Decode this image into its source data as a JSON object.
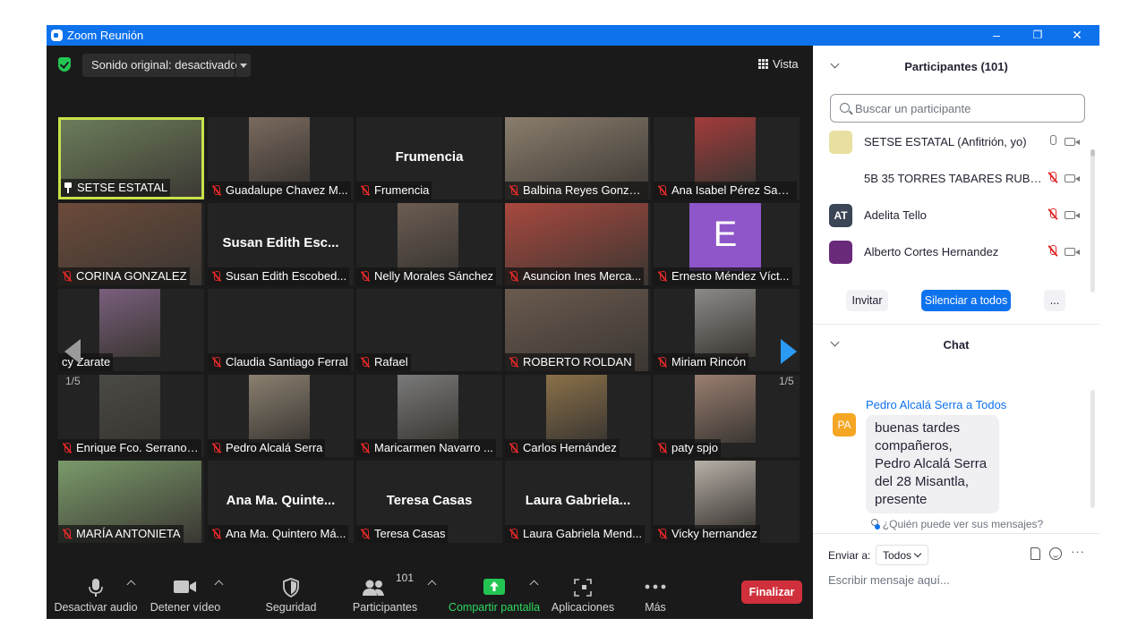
{
  "window": {
    "title": "Zoom Reunión",
    "minimize": "–",
    "restore": "❐",
    "close": "✕"
  },
  "stage": {
    "audio_original": "Sonido original: desactivado",
    "view_label": "Vista",
    "page_left": "1/5",
    "page_right": "1/5"
  },
  "tiles": [
    {
      "label": "SETSE ESTATAL",
      "big": "",
      "muted": false,
      "pinned": true,
      "video": "full",
      "color": "#6b7c5a"
    },
    {
      "label": "Guadalupe Chavez M...",
      "big": "",
      "muted": true,
      "video": "center",
      "color": "#7a6a5e"
    },
    {
      "label": "Frumencia",
      "big": "Frumencia",
      "muted": true,
      "video": "none",
      "color": ""
    },
    {
      "label": "Balbina Reyes Gonzal...",
      "big": "",
      "muted": true,
      "video": "full",
      "color": "#8a7e6d"
    },
    {
      "label": "Ana Isabel Pérez Sant...",
      "big": "",
      "muted": true,
      "video": "center",
      "color": "#a33b3b"
    },
    {
      "label": "CORINA GONZALEZ",
      "big": "",
      "muted": true,
      "video": "full",
      "color": "#6b4a3a"
    },
    {
      "label": "Susan Edith Escobed...",
      "big": "Susan Edith Esc...",
      "muted": true,
      "video": "none",
      "color": ""
    },
    {
      "label": "Nelly Morales Sánchez",
      "big": "",
      "muted": true,
      "video": "center",
      "color": "#6c5d52"
    },
    {
      "label": "Asuncion Ines Merca...",
      "big": "",
      "muted": true,
      "video": "full",
      "color": "#a8483e"
    },
    {
      "label": "Ernesto Méndez Víct...",
      "big": "",
      "muted": true,
      "video": "avatar",
      "color": "#8e56c8",
      "avatar_letter": "E"
    },
    {
      "label": "cy Zarate",
      "big": "",
      "muted": false,
      "video": "center",
      "color": "#7a5f7e"
    },
    {
      "label": "Claudia Santiago Ferral",
      "big": "",
      "muted": true,
      "video": "none",
      "color": ""
    },
    {
      "label": "Rafael",
      "big": "",
      "muted": true,
      "video": "none",
      "color": ""
    },
    {
      "label": "ROBERTO ROLDAN",
      "big": "",
      "muted": true,
      "video": "full",
      "color": "#6a5a4e"
    },
    {
      "label": "Miriam Rincón",
      "big": "",
      "muted": true,
      "video": "center",
      "color": "#8c8a88"
    },
    {
      "label": "Enrique Fco. Serrano ...",
      "big": "",
      "muted": true,
      "video": "center",
      "color": "#4a4a44"
    },
    {
      "label": "Pedro Alcalá Serra",
      "big": "",
      "muted": true,
      "video": "center",
      "color": "#8a8070"
    },
    {
      "label": "Maricarmen Navarro ...",
      "big": "",
      "muted": true,
      "video": "center",
      "color": "#7a7a7a"
    },
    {
      "label": "Carlos Hernández",
      "big": "",
      "muted": true,
      "video": "center",
      "color": "#8a7048"
    },
    {
      "label": "paty spjo",
      "big": "",
      "muted": true,
      "video": "center",
      "color": "#9a7e70"
    },
    {
      "label": "MARÍA ANTONIETA",
      "big": "",
      "muted": true,
      "video": "full",
      "color": "#7a9a6a"
    },
    {
      "label": "Ana Ma. Quintero Má...",
      "big": "Ana Ma. Quinte...",
      "muted": true,
      "video": "none",
      "color": ""
    },
    {
      "label": "Teresa Casas",
      "big": "Teresa Casas",
      "muted": true,
      "video": "none",
      "color": ""
    },
    {
      "label": "Laura Gabriela Mend...",
      "big": "Laura Gabriela...",
      "muted": true,
      "video": "none",
      "color": ""
    },
    {
      "label": "Vicky hernandez",
      "big": "",
      "muted": true,
      "video": "center",
      "color": "#b8b0a8"
    }
  ],
  "toolbar": {
    "mute_audio": "Desactivar audio",
    "stop_video": "Detener vídeo",
    "security": "Seguridad",
    "participants": "Participantes",
    "participants_count": "101",
    "share_screen": "Compartir pantalla",
    "apps": "Aplicaciones",
    "more": "Más",
    "end": "Finalizar"
  },
  "participants_panel": {
    "title": "Participantes (101)",
    "search_placeholder": "Buscar un participante",
    "rows": [
      {
        "name": "SETSE ESTATAL (Anfitrión, yo)",
        "avatar": "",
        "avatar_color": "#e8e0a0",
        "mic_muted": false
      },
      {
        "name": "5B 35 TORRES TABARES RUBEN ...",
        "avatar": "",
        "avatar_color": "",
        "mic_muted": true
      },
      {
        "name": "Adelita Tello",
        "avatar": "AT",
        "avatar_color": "#3a4556",
        "mic_muted": true
      },
      {
        "name": "Alberto Cortes Hernandez",
        "avatar": "",
        "avatar_color": "#6a2a7a",
        "mic_muted": true
      }
    ],
    "invite": "Invitar",
    "mute_all": "Silenciar a todos",
    "more": "..."
  },
  "chat": {
    "title": "Chat",
    "messages": [
      {
        "sender": "Pedro Alcalá Serra a Todos",
        "avatar": "PA",
        "text": "buenas tardes compañeros, Pedro Alcalá Serra del 28 Misantla, presente"
      }
    ],
    "who_can_see": "¿Quién puede ver sus mensajes?",
    "send_to_label": "Enviar a:",
    "send_to_value": "Todos",
    "input_placeholder": "Escribir mensaje aquí...",
    "more": "···"
  }
}
